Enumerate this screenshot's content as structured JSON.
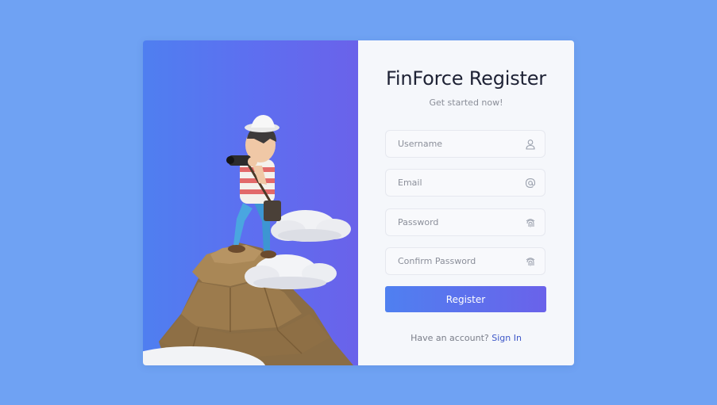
{
  "register": {
    "title": "FinForce Register",
    "subtitle": "Get started now!",
    "fields": {
      "username": {
        "placeholder": "Username",
        "icon": "user-icon"
      },
      "email": {
        "placeholder": "Email",
        "icon": "at-sign-icon"
      },
      "password": {
        "placeholder": "Password",
        "icon": "fingerprint-icon"
      },
      "confirm_password": {
        "placeholder": "Confirm Password",
        "icon": "fingerprint-icon"
      }
    },
    "button_label": "Register",
    "have_account_text": "Have an account?",
    "sign_in_link": "Sign In"
  },
  "colors": {
    "page_background": "#6fa2f3",
    "panel_background": "#f5f7fb",
    "gradient_start": "#4f80f0",
    "gradient_end": "#6a62ea",
    "link": "#3d57c8"
  }
}
